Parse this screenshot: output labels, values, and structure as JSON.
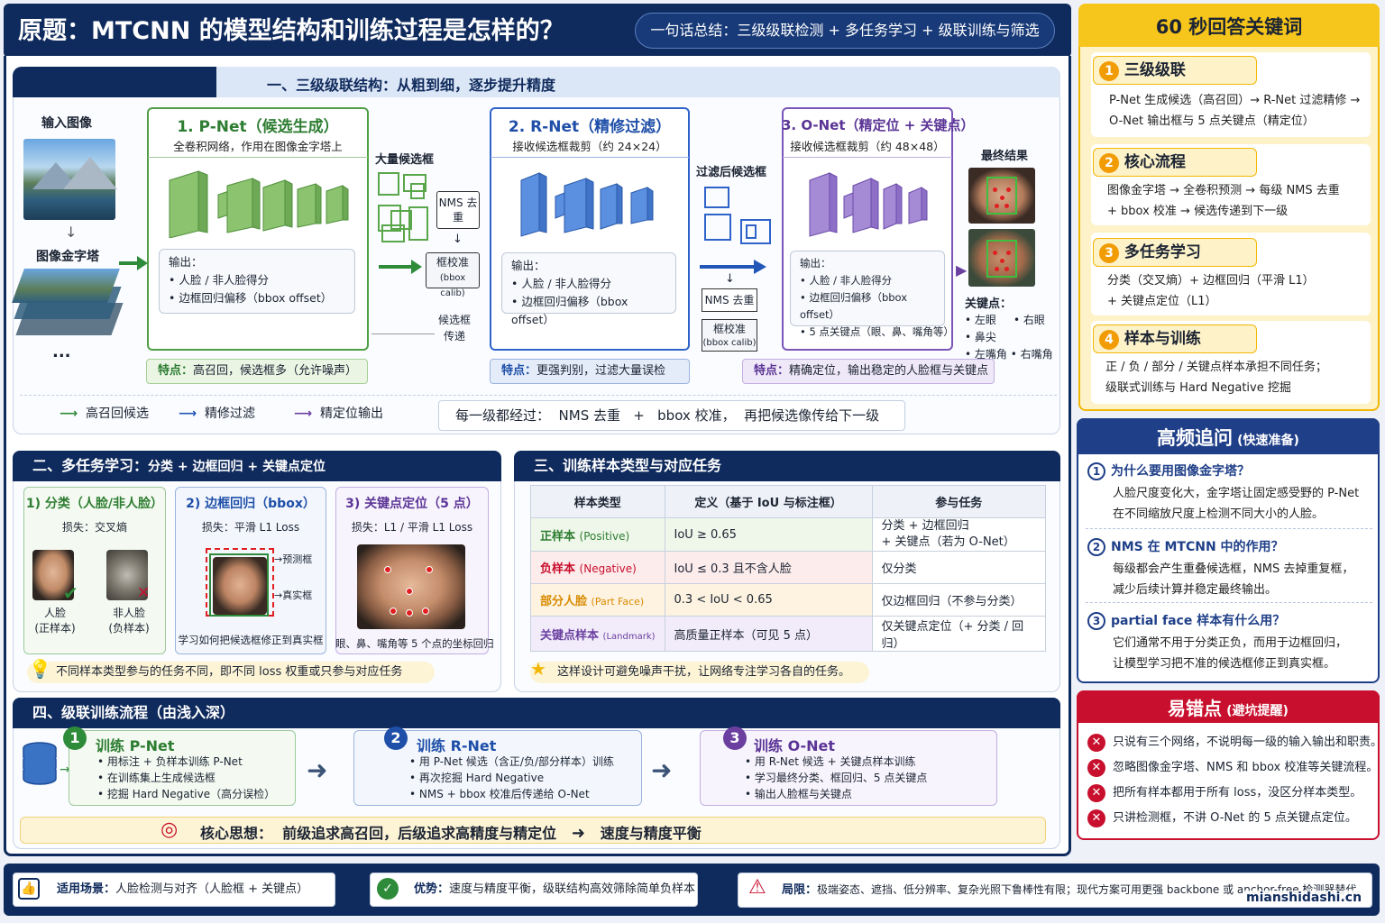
{
  "header": {
    "title": "原题：MTCNN 的模型结构和训练过程是怎样的？",
    "summary": "一句话总结：三级级联检测 + 多任务学习 + 级联训练与筛选"
  },
  "sec1": {
    "title": "一、三级级联结构：从粗到细，逐步提升精度",
    "input_label": "输入图像",
    "pyramid_label": "图像金字塔",
    "dots": "...",
    "pnet": {
      "title": "1. P-Net（候选生成）",
      "sub": "全卷积网络，作用在图像金字塔上",
      "out_title": "输出：",
      "outs": [
        "人脸 / 非人脸得分",
        "边框回归偏移（bbox offset）"
      ],
      "feature_key": "特点：",
      "feature": "高召回，候选框多（允许噪声）"
    },
    "cand_label": "大量候选框",
    "nms": "NMS 去重",
    "calib": "框校准",
    "calib_sub": "(bbox calib)",
    "pass_label": "候选框 传递",
    "rnet": {
      "title": "2. R-Net（精修过滤）",
      "sub": "接收候选框裁剪（约 24×24）",
      "out_title": "输出：",
      "outs": [
        "人脸 / 非人脸得分",
        "边框回归偏移（bbox offset）"
      ],
      "feature_key": "特点：",
      "feature": "更强判别，过滤大量误检"
    },
    "filtered_label": "过滤后候选框",
    "onet": {
      "title": "3. O-Net（精定位 + 关键点）",
      "sub": "接收候选框裁剪（约 48×48）",
      "out_title": "输出：",
      "outs": [
        "人脸 / 非人脸得分",
        "边框回归偏移（bbox offset）",
        "5 点关键点（眼、鼻、嘴角等）"
      ],
      "feature_key": "特点：",
      "feature": "精确定位，输出稳定的人脸框与关键点"
    },
    "final_label": "最终结果",
    "kp_title": "关键点：",
    "kps": [
      "左眼",
      "右眼",
      "鼻尖",
      "左嘴角",
      "右嘴角"
    ],
    "legend": [
      "高召回候选",
      "精修过滤",
      "精定位输出"
    ],
    "every_stage": "每一级都经过：  NMS 去重   +   bbox 校准，  再把候选像传给下一级"
  },
  "sec2": {
    "title": "二、多任务学习：",
    "title2": "分类 + 边框回归 + 关键点定位",
    "cards": [
      {
        "title": "1) 分类（人脸/非人脸）",
        "loss": "损失：交叉熵",
        "a": "人脸",
        "a2": "(正样本)",
        "b": "非人脸",
        "b2": "(负样本)"
      },
      {
        "title": "2) 边框回归（bbox）",
        "loss": "损失：平滑 L1 Loss",
        "pred": "预测框",
        "gt": "真实框",
        "cap": "学习如何把候选框修正到真实框"
      },
      {
        "title": "3) 关键点定位（5 点）",
        "loss": "损失：L1 / 平滑 L1 Loss",
        "cap": "眼、鼻、嘴角等 5 个点的坐标回归"
      }
    ],
    "tip": "不同样本类型参与的任务不同，即不同 loss 权重或只参与对应任务"
  },
  "sec3": {
    "title": "三、训练样本类型与对应任务",
    "headers": [
      "样本类型",
      "定义（基于 IoU 与标注框）",
      "参与任务"
    ],
    "rows": [
      {
        "type": "正样本",
        "en": "(Positive)",
        "def": "IoU ≥ 0.65",
        "task": "分类 + 边框回归",
        "task2": "+ 关键点（若为 O-Net）",
        "color": "#2e7d32"
      },
      {
        "type": "负样本",
        "en": "(Negative)",
        "def": "IoU ≤ 0.3 且不含人脸",
        "task": "仅分类",
        "task2": "",
        "color": "#c8102e"
      },
      {
        "type": "部分人脸",
        "en": "(Part Face)",
        "def": "0.3 < IoU < 0.65",
        "task": "仅边框回归（不参与分类）",
        "task2": "",
        "color": "#d98a00"
      },
      {
        "type": "关键点样本",
        "en": "(Landmark)",
        "def": "高质量正样本（可见 5 点）",
        "task": "仅关键点定位（+ 分类 / 回归）",
        "task2": "",
        "color": "#6a3fa0"
      }
    ],
    "tip": "这样设计可避免噪声干扰，让网络专注学习各自的任务。"
  },
  "sec4": {
    "title": "四、级联训练流程（由浅入深）",
    "steps": [
      {
        "num": "1",
        "title": "训练 P-Net",
        "items": [
          "用标注 + 负样本训练 P-Net",
          "在训练集上生成候选框",
          "挖掘 Hard Negative（高分误检）"
        ]
      },
      {
        "num": "2",
        "title": "训练 R-Net",
        "items": [
          "用 P-Net 候选（含正/负/部分样本）训练",
          "再次挖掘 Hard Negative",
          "NMS + bbox 校准后传递给 O-Net"
        ]
      },
      {
        "num": "3",
        "title": "训练 O-Net",
        "items": [
          "用 R-Net 候选 + 关键点样本训练",
          "学习最终分类、框回归、5 点关键点",
          "输出人脸框与关键点"
        ]
      }
    ],
    "core_key": "核心思想：",
    "core": "前级追求高召回，后级追求高精度与精定位",
    "core2": "速度与精度平衡"
  },
  "side": {
    "title": "60 秒回答关键词",
    "items": [
      {
        "num": "1",
        "title": "三级级联",
        "lines": [
          "P-Net 生成候选（高召回）→ R-Net 过滤精修 →",
          "O-Net 输出框与 5 点关键点（精定位）"
        ]
      },
      {
        "num": "2",
        "title": "核心流程",
        "lines": [
          "图像金字塔 → 全卷积预测 → 每级 NMS 去重",
          "+ bbox 校准 → 候选传递到下一级"
        ]
      },
      {
        "num": "3",
        "title": "多任务学习",
        "lines": [
          "分类（交叉熵）+ 边框回归（平滑 L1）",
          "+ 关键点定位（L1）"
        ]
      },
      {
        "num": "4",
        "title": "样本与训练",
        "lines": [
          "正 / 负 / 部分 / 关键点样本承担不同任务；",
          "级联式训练与 Hard Negative 挖掘"
        ]
      }
    ]
  },
  "faq": {
    "title": "高频追问",
    "title_sub": "(快速准备)",
    "items": [
      {
        "num": "1",
        "q": "为什么要用图像金字塔？",
        "a": [
          "人脸尺度变化大，金字塔让固定感受野的 P-Net",
          "在不同缩放尺度上检测不同大小的人脸。"
        ]
      },
      {
        "num": "2",
        "q": "NMS 在 MTCNN 中的作用？",
        "a": [
          "每级都会产生重叠候选框，NMS 去掉重复框，",
          "减少后续计算并稳定最终输出。"
        ]
      },
      {
        "num": "3",
        "q": "partial face 样本有什么用？",
        "a": [
          "它们通常不用于分类正负，而用于边框回归，",
          "让模型学习把不准的候选框修正到真实框。"
        ]
      }
    ]
  },
  "errors": {
    "title": "易错点",
    "title_sub": "(避坑提醒)",
    "items": [
      "只说有三个网络，不说明每一级的输入输出和职责。",
      "忽略图像金字塔、NMS 和 bbox 校准等关键流程。",
      "把所有样本都用于所有 loss，没区分样本类型。",
      "只讲检测框，不讲 O-Net 的 5 点关键点定位。"
    ]
  },
  "footer": {
    "scene_key": "适用场景：",
    "scene": "人脸检测与对齐（人脸框 + 关键点）",
    "adv_key": "优势：",
    "adv": "速度与精度平衡，级联结构高效筛除简单负样本",
    "lim_key": "局限：",
    "lim": "极端姿态、遮挡、低分辨率、复杂光照下鲁棒性有限；现代方案可用更强 backbone 或 anchor-free 检测器替代。",
    "watermark": "mianshidashi.cn"
  },
  "colors": {
    "navy": "#0f2a5c",
    "green": "#2e8b3a",
    "blue": "#2257b8",
    "purple": "#6a3fa0",
    "gold": "#f2b705"
  }
}
